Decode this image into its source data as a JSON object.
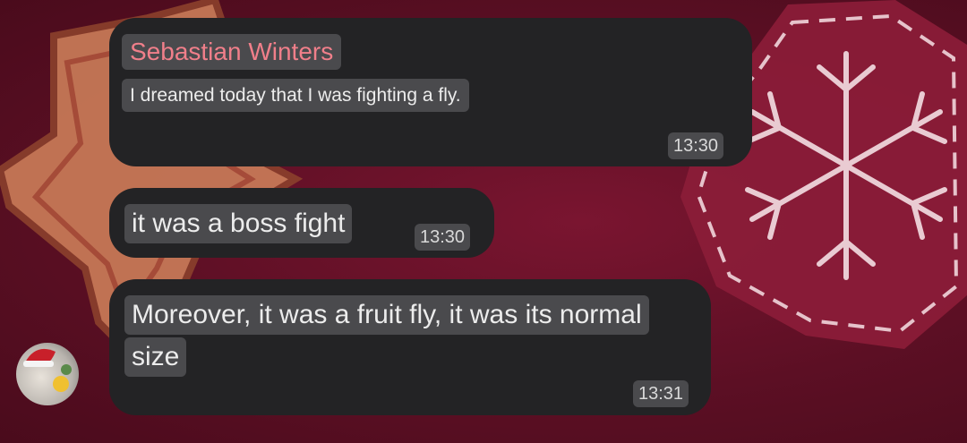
{
  "chat": {
    "sender_name": "Sebastian Winters",
    "messages": [
      {
        "text": "I dreamed today that I was fighting a fly.",
        "time": "13:30"
      },
      {
        "text": "it was a boss fight",
        "time": "13:30"
      },
      {
        "text_line1": "Moreover, it was a fruit fly, it was its normal",
        "text_line2": "size",
        "time": "13:31"
      }
    ]
  },
  "colors": {
    "background": "#5c0f24",
    "bubble": "#232325",
    "sender_name": "#f07f8a",
    "text_highlight": "#4a4a4d"
  },
  "avatar": {
    "icon": "santa-hat-photo-avatar"
  },
  "wallpaper": {
    "icons": [
      "gingerbread-star-icon",
      "snowflake-cookie-icon"
    ]
  }
}
